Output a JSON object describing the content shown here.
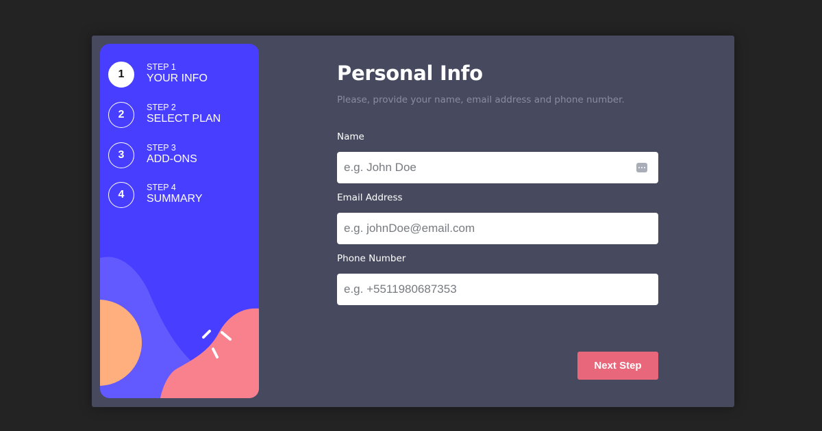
{
  "steps": [
    {
      "number": "1",
      "label_small": "STEP 1",
      "label": "YOUR INFO",
      "active": true
    },
    {
      "number": "2",
      "label_small": "STEP 2",
      "label": "SELECT PLAN",
      "active": false
    },
    {
      "number": "3",
      "label_small": "STEP 3",
      "label": "ADD-ONS",
      "active": false
    },
    {
      "number": "4",
      "label_small": "STEP 4",
      "label": "SUMMARY",
      "active": false
    }
  ],
  "form": {
    "title": "Personal Info",
    "subtitle": "Please, provide your name, email address and phone number.",
    "fields": [
      {
        "label": "Name",
        "placeholder": "e.g. John Doe",
        "value": ""
      },
      {
        "label": "Email Address",
        "placeholder": "e.g. johnDoe@email.com",
        "value": ""
      },
      {
        "label": "Phone Number",
        "placeholder": "e.g. +5511980687353",
        "value": ""
      }
    ],
    "next_label": "Next Step"
  },
  "colors": {
    "background": "#232323",
    "card": "#474a5e",
    "sidebar": "#483eff",
    "blob_violet": "#6259ff",
    "blob_orange": "#ffaf7e",
    "blob_pink": "#f9818e",
    "button": "#e8677b"
  },
  "icons": {
    "autofill": "autofill-icon"
  }
}
